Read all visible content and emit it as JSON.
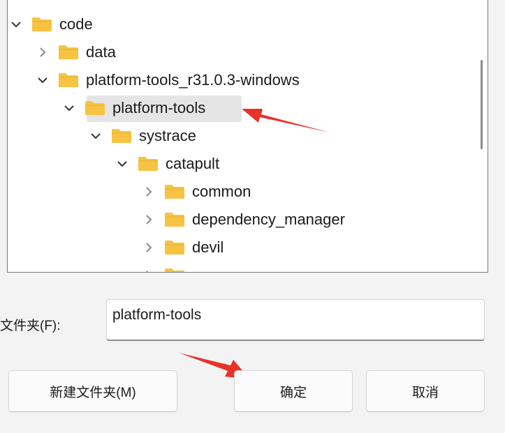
{
  "tree": {
    "items": [
      {
        "label": "code",
        "state": "expanded"
      },
      {
        "label": "data",
        "state": "collapsed"
      },
      {
        "label": "platform-tools_r31.0.3-windows",
        "state": "expanded"
      },
      {
        "label": "platform-tools",
        "state": "expanded",
        "selected": true
      },
      {
        "label": "systrace",
        "state": "expanded"
      },
      {
        "label": "catapult",
        "state": "expanded"
      },
      {
        "label": "common",
        "state": "collapsed"
      },
      {
        "label": "dependency_manager",
        "state": "collapsed"
      },
      {
        "label": "devil",
        "state": "collapsed"
      }
    ]
  },
  "folder_field": {
    "label": "文件夹(F):",
    "value": "platform-tools"
  },
  "buttons": {
    "new_folder": "新建文件夹(M)",
    "ok": "确定",
    "cancel": "取消"
  },
  "colors": {
    "folder": "#f6c343",
    "selection": "#e5e5e5",
    "annotation_arrow": "#e8332a"
  },
  "icons": {
    "folder": "folder-icon",
    "expanded": "chevron-down-icon",
    "collapsed": "chevron-right-icon",
    "annotation": "red-arrow-annotation"
  }
}
